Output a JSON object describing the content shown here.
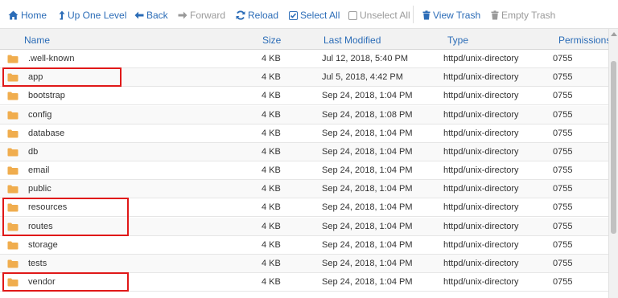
{
  "toolbar": {
    "home": "Home",
    "up_one_level": "Up One Level",
    "back": "Back",
    "forward": "Forward",
    "reload": "Reload",
    "select_all": "Select All",
    "unselect_all": "Unselect All",
    "view_trash": "View Trash",
    "empty_trash": "Empty Trash"
  },
  "columns": {
    "name": "Name",
    "size": "Size",
    "modified": "Last Modified",
    "type": "Type",
    "permissions": "Permissions"
  },
  "files": [
    {
      "name": ".well-known",
      "size": "4 KB",
      "modified": "Jul 12, 2018, 5:40 PM",
      "type": "httpd/unix-directory",
      "perm": "0755",
      "highlighted": false
    },
    {
      "name": "app",
      "size": "4 KB",
      "modified": "Jul 5, 2018, 4:42 PM",
      "type": "httpd/unix-directory",
      "perm": "0755",
      "highlighted": true
    },
    {
      "name": "bootstrap",
      "size": "4 KB",
      "modified": "Sep 24, 2018, 1:04 PM",
      "type": "httpd/unix-directory",
      "perm": "0755",
      "highlighted": false
    },
    {
      "name": "config",
      "size": "4 KB",
      "modified": "Sep 24, 2018, 1:08 PM",
      "type": "httpd/unix-directory",
      "perm": "0755",
      "highlighted": false
    },
    {
      "name": "database",
      "size": "4 KB",
      "modified": "Sep 24, 2018, 1:04 PM",
      "type": "httpd/unix-directory",
      "perm": "0755",
      "highlighted": false
    },
    {
      "name": "db",
      "size": "4 KB",
      "modified": "Sep 24, 2018, 1:04 PM",
      "type": "httpd/unix-directory",
      "perm": "0755",
      "highlighted": false
    },
    {
      "name": "email",
      "size": "4 KB",
      "modified": "Sep 24, 2018, 1:04 PM",
      "type": "httpd/unix-directory",
      "perm": "0755",
      "highlighted": false
    },
    {
      "name": "public",
      "size": "4 KB",
      "modified": "Sep 24, 2018, 1:04 PM",
      "type": "httpd/unix-directory",
      "perm": "0755",
      "highlighted": false
    },
    {
      "name": "resources",
      "size": "4 KB",
      "modified": "Sep 24, 2018, 1:04 PM",
      "type": "httpd/unix-directory",
      "perm": "0755",
      "highlighted": true
    },
    {
      "name": "routes",
      "size": "4 KB",
      "modified": "Sep 24, 2018, 1:04 PM",
      "type": "httpd/unix-directory",
      "perm": "0755",
      "highlighted": true
    },
    {
      "name": "storage",
      "size": "4 KB",
      "modified": "Sep 24, 2018, 1:04 PM",
      "type": "httpd/unix-directory",
      "perm": "0755",
      "highlighted": false
    },
    {
      "name": "tests",
      "size": "4 KB",
      "modified": "Sep 24, 2018, 1:04 PM",
      "type": "httpd/unix-directory",
      "perm": "0755",
      "highlighted": false
    },
    {
      "name": "vendor",
      "size": "4 KB",
      "modified": "Sep 24, 2018, 1:04 PM",
      "type": "httpd/unix-directory",
      "perm": "0755",
      "highlighted": true
    }
  ],
  "icons": {
    "folder": "folder-icon",
    "home": "home-icon",
    "up": "level-up-icon",
    "back": "arrow-left-icon",
    "forward": "arrow-right-icon",
    "reload": "refresh-icon",
    "select_all": "checkbox-checked-icon",
    "unselect_all": "checkbox-empty-icon",
    "trash": "trash-icon"
  },
  "colors": {
    "link": "#2b6cb7",
    "disabled": "#9a9a9a",
    "folder": "#f0ad4e",
    "highlight": "#e01818",
    "header_bg": "#f2f2f2"
  }
}
